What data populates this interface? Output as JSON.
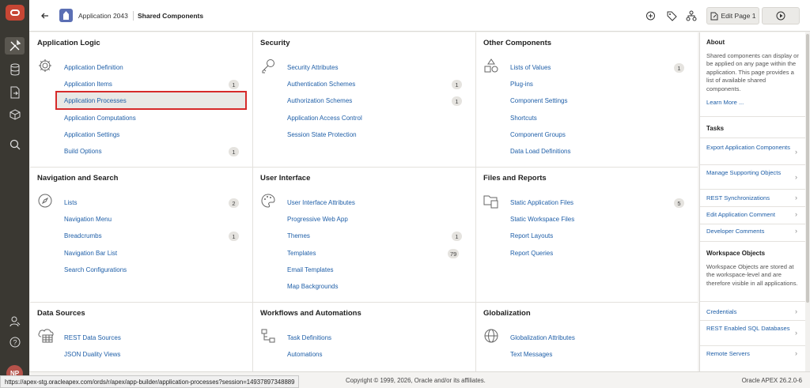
{
  "header": {
    "app_name": "Application 2043",
    "page_title": "Shared Components",
    "edit_page_label": "Edit Page 1"
  },
  "rail": {
    "avatar_initials": "NP"
  },
  "cards": {
    "app_logic": {
      "title": "Application Logic",
      "items": [
        {
          "label": "Application Definition"
        },
        {
          "label": "Application Items",
          "badge": "1"
        },
        {
          "label": "Application Processes"
        },
        {
          "label": "Application Computations"
        },
        {
          "label": "Application Settings"
        },
        {
          "label": "Build Options",
          "badge": "1"
        }
      ]
    },
    "security": {
      "title": "Security",
      "items": [
        {
          "label": "Security Attributes"
        },
        {
          "label": "Authentication Schemes",
          "badge": "1"
        },
        {
          "label": "Authorization Schemes",
          "badge": "1"
        },
        {
          "label": "Application Access Control"
        },
        {
          "label": "Session State Protection"
        }
      ]
    },
    "other": {
      "title": "Other Components",
      "items": [
        {
          "label": "Lists of Values",
          "badge": "1"
        },
        {
          "label": "Plug-ins"
        },
        {
          "label": "Component Settings"
        },
        {
          "label": "Shortcuts"
        },
        {
          "label": "Component Groups"
        },
        {
          "label": "Data Load Definitions"
        }
      ]
    },
    "nav": {
      "title": "Navigation and Search",
      "items": [
        {
          "label": "Lists",
          "badge": "2"
        },
        {
          "label": "Navigation Menu"
        },
        {
          "label": "Breadcrumbs",
          "badge": "1"
        },
        {
          "label": "Navigation Bar List"
        },
        {
          "label": "Search Configurations"
        }
      ]
    },
    "ui": {
      "title": "User Interface",
      "items": [
        {
          "label": "User Interface Attributes"
        },
        {
          "label": "Progressive Web App"
        },
        {
          "label": "Themes",
          "badge": "1"
        },
        {
          "label": "Templates",
          "badge": "79"
        },
        {
          "label": "Email Templates"
        },
        {
          "label": "Map Backgrounds"
        }
      ]
    },
    "files": {
      "title": "Files and Reports",
      "items": [
        {
          "label": "Static Application Files",
          "badge": "5"
        },
        {
          "label": "Static Workspace Files"
        },
        {
          "label": "Report Layouts"
        },
        {
          "label": "Report Queries"
        }
      ]
    },
    "data": {
      "title": "Data Sources",
      "items": [
        {
          "label": "REST Data Sources"
        },
        {
          "label": "JSON Duality Views"
        }
      ]
    },
    "workflows": {
      "title": "Workflows and Automations",
      "items": [
        {
          "label": "Task Definitions"
        },
        {
          "label": "Automations"
        }
      ]
    },
    "glob": {
      "title": "Globalization",
      "items": [
        {
          "label": "Globalization Attributes"
        },
        {
          "label": "Text Messages"
        }
      ]
    }
  },
  "sidebar": {
    "about_title": "About",
    "about_text": "Shared components can display or be applied on any page within the application. This page provides a list of available shared components.",
    "learn_more": "Learn More ...",
    "tasks_title": "Tasks",
    "tasks": [
      "Export Application Components",
      "Manage Supporting Objects",
      "REST Synchronizations",
      "Edit Application Comment",
      "Developer Comments"
    ],
    "ws_title": "Workspace Objects",
    "ws_text": "Workspace Objects are stored at the workspace-level and are therefore visible in all applications.",
    "ws_links": [
      "Credentials",
      "REST Enabled SQL Databases",
      "Remote Servers"
    ]
  },
  "footer": {
    "copyright": "Copyright © 1999, 2026, Oracle and/or its affiliates.",
    "version": "Oracle APEX 26.2.0-6"
  },
  "statusbar": {
    "url": "https://apex-stg.oracleapex.com/ords/r/apex/app-builder/application-processes?session=14937897348889"
  }
}
